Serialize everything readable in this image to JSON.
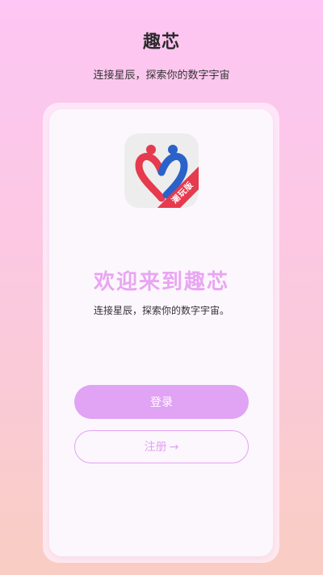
{
  "header": {
    "title": "趣芯",
    "subtitle": "连接星辰，探索你的数字宇宙"
  },
  "logo": {
    "icon": "heart-people-logo-icon",
    "badge": "潮玩版",
    "colors": {
      "red": "#e63a4e",
      "blue": "#2a62c9",
      "tile": "#ededed"
    }
  },
  "welcome": {
    "title": "欢迎来到趣芯",
    "subtitle": "连接星辰，探索你的数字宇宙。"
  },
  "actions": {
    "login_label": "登录",
    "register_label": "注册",
    "register_arrow": "→"
  },
  "colors": {
    "accent": "#e1a3f3",
    "background_top": "#fdc6f4",
    "background_bottom": "#f9cdc3"
  }
}
